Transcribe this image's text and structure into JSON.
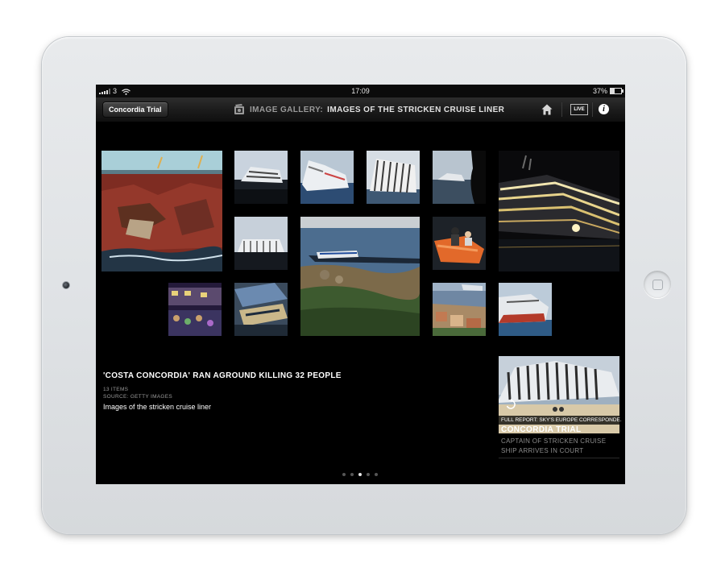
{
  "status_bar": {
    "carrier": "3",
    "time": "17:09",
    "battery": "37%",
    "battery_level": 0.37
  },
  "nav": {
    "back_label": "Concordia Trial",
    "section": "IMAGE GALLERY:",
    "title": "IMAGES OF THE STRICKEN CRUISE LINER",
    "icons": [
      "gallery-icon",
      "home-icon",
      "live-tv-icon",
      "info-icon"
    ],
    "live_label": "LIVE",
    "info_label": "i"
  },
  "gallery": {
    "headline": "'COSTA CONCORDIA' RAN AGROUND KILLING 32 PEOPLE",
    "items_count": "13 ITEMS",
    "source": "SOURCE: GETTY IMAGES",
    "description": "Images of the stricken cruise liner",
    "thumbnails": [
      "hull-damage",
      "capsized-ship-1",
      "capsized-ship-2",
      "capsized-ship-3",
      "rescue-worker-silhouette",
      "ship-lit-night",
      "capsized-ship-4",
      "aerial-coast-view",
      "lifeboat-rescue",
      "night-crowd",
      "ship-interior",
      "harbour-town",
      "capsized-ship-close"
    ]
  },
  "promo": {
    "caption": "FULL REPORT: SKY'S EUROPE CORRESPONDE...",
    "title": "CONCORDIA TRIAL",
    "subtitle": "CAPTAIN OF STRICKEN CRUISE SHIP ARRIVES IN COURT"
  },
  "pagination": {
    "total": 5,
    "current": 3
  },
  "colors": {
    "screen": "#000000",
    "frame": "#e2e5e8",
    "accent_text": "#ffffff",
    "muted_text": "#9a9a9a"
  }
}
